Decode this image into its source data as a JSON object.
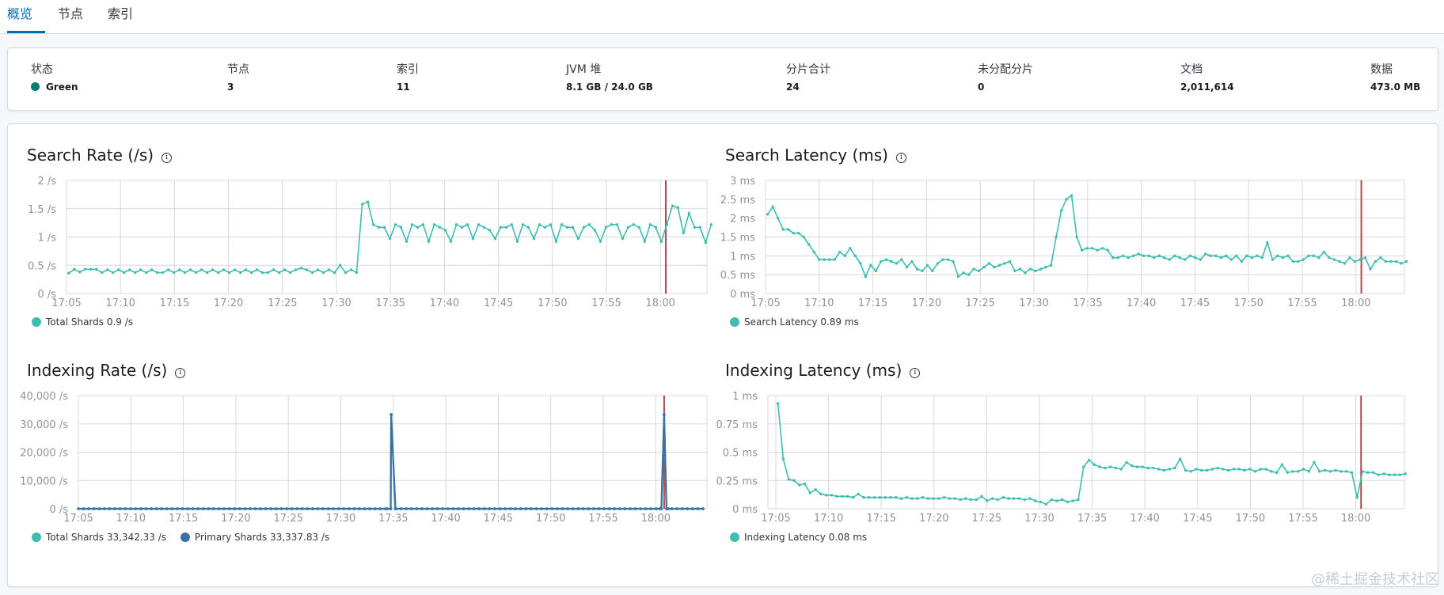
{
  "tabs": [
    "概览",
    "节点",
    "索引"
  ],
  "summary": [
    {
      "label": "状态",
      "value": "Green",
      "dot": "#017d73"
    },
    {
      "label": "节点",
      "value": "3"
    },
    {
      "label": "索引",
      "value": "11"
    },
    {
      "label": "JVM 堆",
      "value": "8.1 GB / 24.0 GB"
    },
    {
      "label": "分片合计",
      "value": "24"
    },
    {
      "label": "未分配分片",
      "value": "0"
    },
    {
      "label": "文档",
      "value": "2,011,614"
    },
    {
      "label": "数据",
      "value": "473.0 MB"
    }
  ],
  "colors": {
    "teal": "#3ebeb0",
    "blue": "#3b6fa5",
    "marker": "#b2474a",
    "grid": "#d8d8d8",
    "tick": "#8f929a"
  },
  "chart_data": [
    {
      "id": "search-rate",
      "type": "line",
      "title": "Search Rate (/s)",
      "x_ticks": [
        "17:05",
        "17:10",
        "17:15",
        "17:20",
        "17:25",
        "17:30",
        "17:35",
        "17:40",
        "17:45",
        "17:50",
        "17:55",
        "18:00"
      ],
      "y_ticks": [
        "0 /s",
        "0.5 /s",
        "1 /s",
        "1.5 /s",
        "2 /s"
      ],
      "ylim": [
        0,
        2
      ],
      "x_range_min": [
        0,
        60
      ],
      "marker_min": 55.5,
      "series": [
        {
          "name": "Total Shards",
          "legend_value": "0.9 /s",
          "color": "#3ebeb0",
          "values": [
            0.36,
            0.43,
            0.38,
            0.43,
            0.43,
            0.43,
            0.37,
            0.42,
            0.37,
            0.42,
            0.37,
            0.42,
            0.37,
            0.42,
            0.37,
            0.42,
            0.37,
            0.37,
            0.42,
            0.37,
            0.42,
            0.37,
            0.42,
            0.37,
            0.42,
            0.37,
            0.42,
            0.37,
            0.42,
            0.37,
            0.42,
            0.37,
            0.42,
            0.37,
            0.42,
            0.37,
            0.37,
            0.42,
            0.37,
            0.42,
            0.37,
            0.42,
            0.45,
            0.42,
            0.37,
            0.42,
            0.37,
            0.42,
            0.37,
            0.5,
            0.37,
            0.42,
            0.37,
            1.58,
            1.62,
            1.22,
            1.17,
            1.17,
            0.97,
            1.22,
            1.17,
            0.92,
            1.22,
            1.17,
            1.22,
            0.92,
            1.22,
            1.17,
            1.12,
            0.92,
            1.22,
            1.17,
            1.22,
            0.97,
            1.22,
            1.17,
            1.12,
            0.97,
            1.17,
            1.17,
            1.22,
            0.92,
            1.22,
            1.17,
            0.97,
            1.22,
            1.17,
            1.22,
            0.92,
            1.22,
            1.17,
            1.17,
            0.97,
            1.17,
            1.22,
            1.12,
            0.92,
            1.17,
            1.22,
            1.22,
            0.97,
            1.17,
            1.22,
            1.17,
            0.92,
            1.22,
            1.17,
            0.92,
            1.22,
            1.55,
            1.52,
            1.07,
            1.42,
            1.17,
            1.17,
            0.9,
            1.22
          ]
        }
      ]
    },
    {
      "id": "search-latency",
      "type": "line",
      "title": "Search Latency (ms)",
      "x_ticks": [
        "17:05",
        "17:10",
        "17:15",
        "17:20",
        "17:25",
        "17:30",
        "17:35",
        "17:40",
        "17:45",
        "17:50",
        "17:55",
        "18:00"
      ],
      "y_ticks": [
        "0 ms",
        "0.5 ms",
        "1 ms",
        "1.5 ms",
        "2 ms",
        "2.5 ms",
        "3 ms"
      ],
      "ylim": [
        0,
        3
      ],
      "x_range_min": [
        0,
        60
      ],
      "marker_min": 55.5,
      "series": [
        {
          "name": "Search Latency",
          "legend_value": "0.89 ms",
          "color": "#3ebeb0",
          "values": [
            2.1,
            2.3,
            2.0,
            1.7,
            1.7,
            1.6,
            1.6,
            1.5,
            1.3,
            1.1,
            0.9,
            0.9,
            0.9,
            0.9,
            1.1,
            1.0,
            1.2,
            1.0,
            0.8,
            0.45,
            0.75,
            0.6,
            0.85,
            0.9,
            0.85,
            0.8,
            0.9,
            0.7,
            0.85,
            0.65,
            0.6,
            0.75,
            0.6,
            0.8,
            0.9,
            0.9,
            0.85,
            0.45,
            0.55,
            0.5,
            0.65,
            0.6,
            0.7,
            0.8,
            0.7,
            0.75,
            0.8,
            0.85,
            0.6,
            0.65,
            0.55,
            0.65,
            0.6,
            0.65,
            0.7,
            0.75,
            1.5,
            2.2,
            2.5,
            2.6,
            1.5,
            1.15,
            1.2,
            1.2,
            1.15,
            1.2,
            1.15,
            0.95,
            0.95,
            1.0,
            0.95,
            1.0,
            1.05,
            1.0,
            1.0,
            0.95,
            1.0,
            0.95,
            0.9,
            1.0,
            0.95,
            0.9,
            1.0,
            0.95,
            0.9,
            1.05,
            1.0,
            1.0,
            0.95,
            1.0,
            0.9,
            1.0,
            0.85,
            1.0,
            0.95,
            1.0,
            0.95,
            1.35,
            0.9,
            1.0,
            0.95,
            1.0,
            0.85,
            0.85,
            0.9,
            1.0,
            1.0,
            0.95,
            1.1,
            0.95,
            0.9,
            0.85,
            0.8,
            0.95,
            0.85,
            0.9,
            0.95,
            0.65,
            0.85,
            0.95,
            0.85,
            0.85,
            0.85,
            0.8,
            0.85
          ]
        }
      ]
    },
    {
      "id": "indexing-rate",
      "type": "line",
      "title": "Indexing Rate (/s)",
      "x_ticks": [
        "17:05",
        "17:10",
        "17:15",
        "17:20",
        "17:25",
        "17:30",
        "17:35",
        "17:40",
        "17:45",
        "17:50",
        "17:55",
        "18:00"
      ],
      "y_ticks": [
        "0 /s",
        "10,000 /s",
        "20,000 /s",
        "30,000 /s",
        "40,000 /s"
      ],
      "ylim": [
        0,
        40000
      ],
      "x_range_min": [
        0,
        60
      ],
      "marker_min": 55.8,
      "spikes_min": [
        29.8,
        55.8
      ],
      "spike_value": 33300,
      "series": [
        {
          "name": "Total Shards",
          "legend_value": "33,342.33 /s",
          "color": "#3ebeb0"
        },
        {
          "name": "Primary Shards",
          "legend_value": "33,337.83 /s",
          "color": "#3b6fa5"
        }
      ]
    },
    {
      "id": "indexing-latency",
      "type": "line",
      "title": "Indexing Latency (ms)",
      "x_ticks": [
        "17:05",
        "17:10",
        "17:15",
        "17:20",
        "17:25",
        "17:30",
        "17:35",
        "17:40",
        "17:45",
        "17:50",
        "17:55",
        "18:00"
      ],
      "y_ticks": [
        "0 ms",
        "0.25 ms",
        "0.5 ms",
        "0.75 ms",
        "1 ms"
      ],
      "ylim": [
        0,
        1
      ],
      "x_range_min": [
        0,
        60
      ],
      "marker_min": 55.5,
      "series": [
        {
          "name": "Indexing Latency",
          "legend_value": "0.08 ms",
          "color": "#3ebeb0",
          "values": [
            0.93,
            0.44,
            0.26,
            0.25,
            0.21,
            0.22,
            0.14,
            0.17,
            0.13,
            0.12,
            0.12,
            0.11,
            0.11,
            0.11,
            0.1,
            0.13,
            0.1,
            0.1,
            0.1,
            0.1,
            0.1,
            0.1,
            0.1,
            0.09,
            0.1,
            0.09,
            0.09,
            0.1,
            0.09,
            0.09,
            0.09,
            0.1,
            0.09,
            0.09,
            0.08,
            0.09,
            0.08,
            0.08,
            0.11,
            0.07,
            0.09,
            0.08,
            0.1,
            0.09,
            0.09,
            0.09,
            0.08,
            0.09,
            0.07,
            0.06,
            0.04,
            0.08,
            0.07,
            0.08,
            0.06,
            0.07,
            0.08,
            0.37,
            0.43,
            0.39,
            0.37,
            0.36,
            0.37,
            0.36,
            0.35,
            0.41,
            0.38,
            0.37,
            0.37,
            0.36,
            0.36,
            0.35,
            0.34,
            0.35,
            0.36,
            0.44,
            0.34,
            0.33,
            0.35,
            0.34,
            0.34,
            0.35,
            0.36,
            0.35,
            0.34,
            0.35,
            0.35,
            0.34,
            0.35,
            0.33,
            0.35,
            0.35,
            0.33,
            0.32,
            0.39,
            0.32,
            0.33,
            0.33,
            0.35,
            0.33,
            0.41,
            0.33,
            0.34,
            0.33,
            0.34,
            0.33,
            0.33,
            0.32,
            0.1,
            0.33,
            0.32,
            0.32,
            0.3,
            0.31,
            0.3,
            0.3,
            0.3,
            0.31
          ]
        }
      ]
    }
  ]
}
